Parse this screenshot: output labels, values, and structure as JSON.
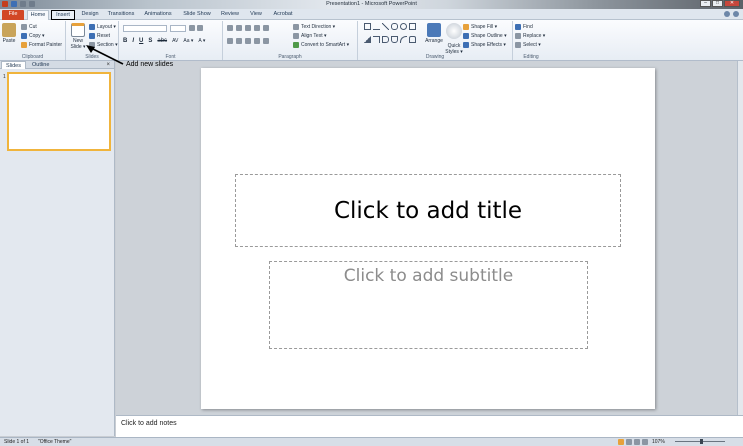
{
  "window": {
    "title": "Presentation1 - Microsoft PowerPoint",
    "controls": [
      "–",
      "□",
      "✕"
    ]
  },
  "ribbon_tabs": [
    "File",
    "Home",
    "Insert",
    "Design",
    "Transitions",
    "Animations",
    "Slide Show",
    "Review",
    "View",
    "Acrobat"
  ],
  "ribbon": {
    "clipboard": {
      "label": "Clipboard",
      "paste": "Paste",
      "cut": "Cut",
      "copy": "Copy ▾",
      "format_painter": "Format Painter"
    },
    "slides": {
      "label": "Slides",
      "new_slide": "New Slide ▾",
      "layout": "Layout ▾",
      "reset": "Reset",
      "section": "Section ▾"
    },
    "font": {
      "label": "Font",
      "bold": "B",
      "italic": "I",
      "underline": "U",
      "shadow": "S",
      "strike": "abc",
      "spacing": "AV",
      "case": "Aa ▾",
      "color": "A ▾"
    },
    "paragraph": {
      "label": "Paragraph",
      "text_direction": "Text Direction ▾",
      "align_text": "Align Text ▾",
      "convert_smartart": "Convert to SmartArt ▾"
    },
    "drawing": {
      "label": "Drawing",
      "arrange": "Arrange",
      "quick_styles": "Quick Styles ▾",
      "shape_fill": "Shape Fill ▾",
      "shape_outline": "Shape Outline ▾",
      "shape_effects": "Shape Effects ▾"
    },
    "editing": {
      "label": "Editing",
      "find": "Find",
      "replace": "Replace ▾",
      "select": "Select ▾"
    }
  },
  "annotation": {
    "text": "Add new slides"
  },
  "left_pane": {
    "tabs": [
      "Slides",
      "Outline"
    ],
    "close": "×",
    "slide_number": "1"
  },
  "slide": {
    "title_placeholder": "Click to add title",
    "subtitle_placeholder": "Click to add subtitle"
  },
  "notes": {
    "placeholder": "Click to add notes"
  },
  "status_bar": {
    "slide_info": "Slide 1 of 1",
    "theme": "\"Office Theme\"",
    "zoom": "107%"
  },
  "colors": {
    "file_tab": "#d24726",
    "highlight_box": "#000000",
    "selected_thumb_border": "#f0b43c"
  }
}
